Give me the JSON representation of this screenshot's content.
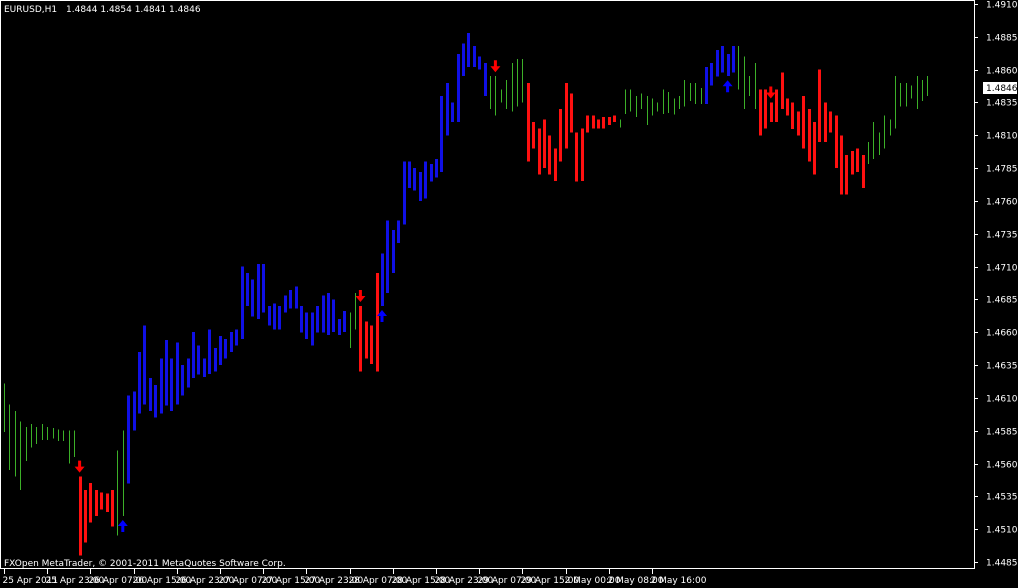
{
  "header": {
    "symbol": "EURUSD,H1",
    "ohlc": "1.4844 1.4854 1.4841 1.4846"
  },
  "footer": {
    "copyright": "FXOpen MetaTrader, © 2001-2011 MetaQuotes Software Corp."
  },
  "colors": {
    "background": "#000000",
    "axis": "#ffffff",
    "neutral_bar": "#3cb028",
    "bull_bar": "#1010e6",
    "bear_bar": "#ff1010",
    "up_arrow": "#0000ff",
    "down_arrow": "#ff0000",
    "price_label_bg": "#ffffff",
    "price_label_text": "#000000"
  },
  "chart_data": {
    "type": "ohlc",
    "instrument": "EURUSD",
    "timeframe": "H1",
    "current_price": "1.4846",
    "ylim": [
      1.4485,
      1.491
    ],
    "y_ticks": [
      "1.4910",
      "1.4885",
      "1.4860",
      "1.4835",
      "1.4810",
      "1.4785",
      "1.4760",
      "1.4735",
      "1.4710",
      "1.4685",
      "1.4660",
      "1.4635",
      "1.4610",
      "1.4585",
      "1.4560",
      "1.4535",
      "1.4510",
      "1.4485"
    ],
    "x_labels": [
      "25 Apr 2011",
      "25 Apr 23:00",
      "26 Apr 07:00",
      "26 Apr 15:00",
      "26 Apr 23:00",
      "27 Apr 07:00",
      "27 Apr 15:00",
      "27 Apr 23:00",
      "28 Apr 07:00",
      "28 Apr 15:00",
      "28 Apr 23:00",
      "29 Apr 07:00",
      "29 Apr 15:00",
      "2 May 00:00",
      "2 May 08:00",
      "2 May 16:00"
    ],
    "bar_label_step": 8,
    "series": [
      {
        "t": "n",
        "h": 1.4621,
        "l": 1.4584
      },
      {
        "t": "n",
        "h": 1.4605,
        "l": 1.4555
      },
      {
        "t": "n",
        "h": 1.46,
        "l": 1.455
      },
      {
        "t": "n",
        "h": 1.4592,
        "l": 1.454
      },
      {
        "t": "n",
        "h": 1.4588,
        "l": 1.4562
      },
      {
        "t": "n",
        "h": 1.459,
        "l": 1.4572
      },
      {
        "t": "n",
        "h": 1.4588,
        "l": 1.4575
      },
      {
        "t": "n",
        "h": 1.459,
        "l": 1.4578
      },
      {
        "t": "n",
        "h": 1.4588,
        "l": 1.4578
      },
      {
        "t": "n",
        "h": 1.4587,
        "l": 1.4579
      },
      {
        "t": "n",
        "h": 1.4586,
        "l": 1.4577
      },
      {
        "t": "n",
        "h": 1.4585,
        "l": 1.4577
      },
      {
        "t": "n",
        "h": 1.4585,
        "l": 1.456
      },
      {
        "t": "n",
        "h": 1.4585,
        "l": 1.4565
      },
      {
        "t": "s",
        "h": 1.455,
        "l": 1.449
      },
      {
        "t": "s",
        "h": 1.454,
        "l": 1.45
      },
      {
        "t": "s",
        "h": 1.4545,
        "l": 1.4515
      },
      {
        "t": "s",
        "h": 1.454,
        "l": 1.452
      },
      {
        "t": "s",
        "h": 1.4538,
        "l": 1.4525
      },
      {
        "t": "s",
        "h": 1.4537,
        "l": 1.4523
      },
      {
        "t": "s",
        "h": 1.454,
        "l": 1.4512
      },
      {
        "t": "n",
        "h": 1.457,
        "l": 1.4505
      },
      {
        "t": "n",
        "h": 1.4585,
        "l": 1.452
      },
      {
        "t": "b",
        "h": 1.4612,
        "l": 1.4545
      },
      {
        "t": "b",
        "h": 1.4615,
        "l": 1.4585
      },
      {
        "t": "b",
        "h": 1.4645,
        "l": 1.4598
      },
      {
        "t": "b",
        "h": 1.4665,
        "l": 1.4605
      },
      {
        "t": "b",
        "h": 1.4625,
        "l": 1.46
      },
      {
        "t": "b",
        "h": 1.462,
        "l": 1.4595
      },
      {
        "t": "b",
        "h": 1.464,
        "l": 1.4598
      },
      {
        "t": "b",
        "h": 1.4654,
        "l": 1.4604
      },
      {
        "t": "b",
        "h": 1.464,
        "l": 1.46
      },
      {
        "t": "b",
        "h": 1.4652,
        "l": 1.4605
      },
      {
        "t": "b",
        "h": 1.4635,
        "l": 1.4612
      },
      {
        "t": "b",
        "h": 1.464,
        "l": 1.4618
      },
      {
        "t": "b",
        "h": 1.466,
        "l": 1.4625
      },
      {
        "t": "b",
        "h": 1.465,
        "l": 1.4628
      },
      {
        "t": "b",
        "h": 1.464,
        "l": 1.4626
      },
      {
        "t": "b",
        "h": 1.4662,
        "l": 1.4628
      },
      {
        "t": "b",
        "h": 1.4648,
        "l": 1.463
      },
      {
        "t": "b",
        "h": 1.4657,
        "l": 1.4635
      },
      {
        "t": "b",
        "h": 1.4655,
        "l": 1.464
      },
      {
        "t": "b",
        "h": 1.466,
        "l": 1.4645
      },
      {
        "t": "b",
        "h": 1.4662,
        "l": 1.465
      },
      {
        "t": "b",
        "h": 1.471,
        "l": 1.4655
      },
      {
        "t": "b",
        "h": 1.4705,
        "l": 1.468
      },
      {
        "t": "b",
        "h": 1.47,
        "l": 1.4672
      },
      {
        "t": "b",
        "h": 1.4712,
        "l": 1.467
      },
      {
        "t": "b",
        "h": 1.4712,
        "l": 1.4675
      },
      {
        "t": "b",
        "h": 1.468,
        "l": 1.4665
      },
      {
        "t": "b",
        "h": 1.4682,
        "l": 1.4662
      },
      {
        "t": "b",
        "h": 1.468,
        "l": 1.4662
      },
      {
        "t": "b",
        "h": 1.4688,
        "l": 1.4675
      },
      {
        "t": "b",
        "h": 1.4692,
        "l": 1.4678
      },
      {
        "t": "b",
        "h": 1.4695,
        "l": 1.4678
      },
      {
        "t": "b",
        "h": 1.468,
        "l": 1.466
      },
      {
        "t": "b",
        "h": 1.4675,
        "l": 1.4655
      },
      {
        "t": "b",
        "h": 1.4675,
        "l": 1.465
      },
      {
        "t": "b",
        "h": 1.468,
        "l": 1.466
      },
      {
        "t": "b",
        "h": 1.4688,
        "l": 1.466
      },
      {
        "t": "b",
        "h": 1.469,
        "l": 1.4658
      },
      {
        "t": "b",
        "h": 1.4685,
        "l": 1.466
      },
      {
        "t": "b",
        "h": 1.467,
        "l": 1.4658
      },
      {
        "t": "b",
        "h": 1.4676,
        "l": 1.466
      },
      {
        "t": "n",
        "h": 1.4675,
        "l": 1.4648
      },
      {
        "t": "n",
        "h": 1.469,
        "l": 1.4662
      },
      {
        "t": "s",
        "h": 1.468,
        "l": 1.463
      },
      {
        "t": "s",
        "h": 1.4668,
        "l": 1.464
      },
      {
        "t": "s",
        "h": 1.4665,
        "l": 1.4636
      },
      {
        "t": "s",
        "h": 1.4705,
        "l": 1.463
      },
      {
        "t": "b",
        "h": 1.472,
        "l": 1.468
      },
      {
        "t": "b",
        "h": 1.4745,
        "l": 1.469
      },
      {
        "t": "b",
        "h": 1.4738,
        "l": 1.4705
      },
      {
        "t": "b",
        "h": 1.4745,
        "l": 1.4728
      },
      {
        "t": "b",
        "h": 1.479,
        "l": 1.4742
      },
      {
        "t": "b",
        "h": 1.479,
        "l": 1.477
      },
      {
        "t": "b",
        "h": 1.4785,
        "l": 1.4768
      },
      {
        "t": "b",
        "h": 1.4782,
        "l": 1.476
      },
      {
        "t": "b",
        "h": 1.479,
        "l": 1.4762
      },
      {
        "t": "b",
        "h": 1.4788,
        "l": 1.4775
      },
      {
        "t": "b",
        "h": 1.4792,
        "l": 1.4778
      },
      {
        "t": "b",
        "h": 1.484,
        "l": 1.4782
      },
      {
        "t": "b",
        "h": 1.485,
        "l": 1.481
      },
      {
        "t": "b",
        "h": 1.4835,
        "l": 1.482
      },
      {
        "t": "b",
        "h": 1.4872,
        "l": 1.482
      },
      {
        "t": "b",
        "h": 1.488,
        "l": 1.4855
      },
      {
        "t": "b",
        "h": 1.4888,
        "l": 1.4862
      },
      {
        "t": "b",
        "h": 1.4878,
        "l": 1.4862
      },
      {
        "t": "b",
        "h": 1.487,
        "l": 1.486
      },
      {
        "t": "b",
        "h": 1.4865,
        "l": 1.484
      },
      {
        "t": "n",
        "h": 1.4855,
        "l": 1.483
      },
      {
        "t": "n",
        "h": 1.4855,
        "l": 1.4825
      },
      {
        "t": "n",
        "h": 1.4845,
        "l": 1.4835
      },
      {
        "t": "n",
        "h": 1.4852,
        "l": 1.483
      },
      {
        "t": "n",
        "h": 1.4865,
        "l": 1.4828
      },
      {
        "t": "n",
        "h": 1.4868,
        "l": 1.4832
      },
      {
        "t": "n",
        "h": 1.4868,
        "l": 1.4835
      },
      {
        "t": "s",
        "h": 1.485,
        "l": 1.479
      },
      {
        "t": "s",
        "h": 1.482,
        "l": 1.48
      },
      {
        "t": "s",
        "h": 1.4815,
        "l": 1.478
      },
      {
        "t": "s",
        "h": 1.4822,
        "l": 1.4785
      },
      {
        "t": "s",
        "h": 1.481,
        "l": 1.478
      },
      {
        "t": "s",
        "h": 1.48,
        "l": 1.4775
      },
      {
        "t": "s",
        "h": 1.483,
        "l": 1.479
      },
      {
        "t": "s",
        "h": 1.485,
        "l": 1.48
      },
      {
        "t": "s",
        "h": 1.4842,
        "l": 1.4812
      },
      {
        "t": "s",
        "h": 1.4812,
        "l": 1.4775
      },
      {
        "t": "s",
        "h": 1.4815,
        "l": 1.4775
      },
      {
        "t": "s",
        "h": 1.4825,
        "l": 1.4812
      },
      {
        "t": "s",
        "h": 1.4825,
        "l": 1.4815
      },
      {
        "t": "s",
        "h": 1.4822,
        "l": 1.4815
      },
      {
        "t": "s",
        "h": 1.4824,
        "l": 1.4815
      },
      {
        "t": "s",
        "h": 1.4824,
        "l": 1.4818
      },
      {
        "t": "s",
        "h": 1.4825,
        "l": 1.482
      },
      {
        "t": "n",
        "h": 1.4822,
        "l": 1.4816
      },
      {
        "t": "n",
        "h": 1.4845,
        "l": 1.4826
      },
      {
        "t": "n",
        "h": 1.4845,
        "l": 1.4828
      },
      {
        "t": "n",
        "h": 1.484,
        "l": 1.4824
      },
      {
        "t": "n",
        "h": 1.4842,
        "l": 1.483
      },
      {
        "t": "n",
        "h": 1.484,
        "l": 1.4818
      },
      {
        "t": "n",
        "h": 1.4838,
        "l": 1.4825
      },
      {
        "t": "n",
        "h": 1.4835,
        "l": 1.4828
      },
      {
        "t": "n",
        "h": 1.4845,
        "l": 1.4826
      },
      {
        "t": "n",
        "h": 1.4843,
        "l": 1.4827
      },
      {
        "t": "n",
        "h": 1.4838,
        "l": 1.4826
      },
      {
        "t": "n",
        "h": 1.484,
        "l": 1.483
      },
      {
        "t": "n",
        "h": 1.4852,
        "l": 1.4832
      },
      {
        "t": "n",
        "h": 1.485,
        "l": 1.4836
      },
      {
        "t": "n",
        "h": 1.485,
        "l": 1.4834
      },
      {
        "t": "n",
        "h": 1.4846,
        "l": 1.4834
      },
      {
        "t": "b",
        "h": 1.4862,
        "l": 1.4834
      },
      {
        "t": "b",
        "h": 1.4865,
        "l": 1.4848
      },
      {
        "t": "b",
        "h": 1.4875,
        "l": 1.4855
      },
      {
        "t": "b",
        "h": 1.4878,
        "l": 1.4858
      },
      {
        "t": "b",
        "h": 1.4872,
        "l": 1.4855
      },
      {
        "t": "b",
        "h": 1.4878,
        "l": 1.4858
      },
      {
        "t": "n",
        "h": 1.4878,
        "l": 1.4845
      },
      {
        "t": "n",
        "h": 1.487,
        "l": 1.483
      },
      {
        "t": "n",
        "h": 1.4855,
        "l": 1.484
      },
      {
        "t": "n",
        "h": 1.4865,
        "l": 1.483
      },
      {
        "t": "s",
        "h": 1.4845,
        "l": 1.481
      },
      {
        "t": "s",
        "h": 1.4845,
        "l": 1.4815
      },
      {
        "t": "s",
        "h": 1.4835,
        "l": 1.482
      },
      {
        "t": "s",
        "h": 1.4845,
        "l": 1.482
      },
      {
        "t": "s",
        "h": 1.4858,
        "l": 1.483
      },
      {
        "t": "s",
        "h": 1.4838,
        "l": 1.4825
      },
      {
        "t": "s",
        "h": 1.4835,
        "l": 1.4815
      },
      {
        "t": "s",
        "h": 1.4828,
        "l": 1.481
      },
      {
        "t": "s",
        "h": 1.484,
        "l": 1.48
      },
      {
        "t": "s",
        "h": 1.483,
        "l": 1.479
      },
      {
        "t": "s",
        "h": 1.482,
        "l": 1.478
      },
      {
        "t": "s",
        "h": 1.486,
        "l": 1.4805
      },
      {
        "t": "s",
        "h": 1.4835,
        "l": 1.4805
      },
      {
        "t": "s",
        "h": 1.4828,
        "l": 1.4812
      },
      {
        "t": "s",
        "h": 1.4825,
        "l": 1.4785
      },
      {
        "t": "s",
        "h": 1.481,
        "l": 1.4765
      },
      {
        "t": "s",
        "h": 1.4795,
        "l": 1.4765
      },
      {
        "t": "s",
        "h": 1.4798,
        "l": 1.478
      },
      {
        "t": "s",
        "h": 1.48,
        "l": 1.4782
      },
      {
        "t": "s",
        "h": 1.4795,
        "l": 1.477
      },
      {
        "t": "n",
        "h": 1.4805,
        "l": 1.4788
      },
      {
        "t": "n",
        "h": 1.482,
        "l": 1.4792
      },
      {
        "t": "n",
        "h": 1.4812,
        "l": 1.4795
      },
      {
        "t": "n",
        "h": 1.4825,
        "l": 1.48
      },
      {
        "t": "n",
        "h": 1.4822,
        "l": 1.481
      },
      {
        "t": "n",
        "h": 1.4855,
        "l": 1.4815
      },
      {
        "t": "n",
        "h": 1.485,
        "l": 1.4832
      },
      {
        "t": "n",
        "h": 1.485,
        "l": 1.4832
      },
      {
        "t": "n",
        "h": 1.4848,
        "l": 1.4838
      },
      {
        "t": "n",
        "h": 1.4855,
        "l": 1.483
      },
      {
        "t": "n",
        "h": 1.4852,
        "l": 1.4836
      },
      {
        "t": "n",
        "h": 1.4855,
        "l": 1.484
      }
    ],
    "signals": [
      {
        "dir": "down",
        "bar": 14
      },
      {
        "dir": "up",
        "bar": 22
      },
      {
        "dir": "down",
        "bar": 66
      },
      {
        "dir": "up",
        "bar": 70
      },
      {
        "dir": "down",
        "bar": 91
      },
      {
        "dir": "up",
        "bar": 134
      },
      {
        "dir": "down",
        "bar": 142
      }
    ]
  }
}
